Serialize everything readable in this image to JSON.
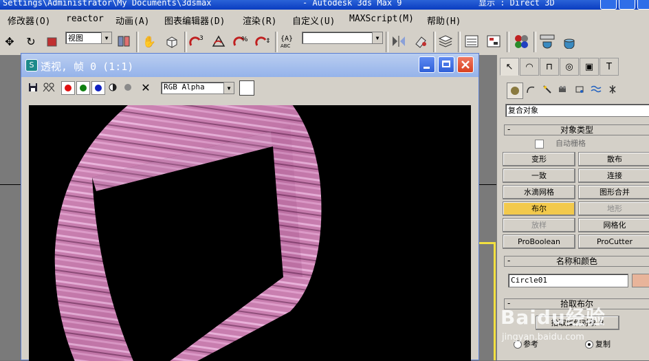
{
  "title_bar": {
    "left_text": "Settings\\Administrator\\My Documents\\3dsmax",
    "app_text": "- Autodesk 3ds Max 9",
    "right_text": "显示 : Direct 3D"
  },
  "menu": [
    "修改器(O)",
    "reactor",
    "动画(A)",
    "图表编辑器(D)",
    "渲染(R)",
    "自定义(U)",
    "MAXScript(M)",
    "帮助(H)"
  ],
  "toolbar": {
    "view_combo": "视图",
    "selection_set_combo": ""
  },
  "render_window": {
    "title": "透视, 帧 0 (1:1)",
    "channel_combo": "RGB Alpha"
  },
  "panel": {
    "category_combo": "复合对象",
    "object_type_title": "对象类型",
    "autogrid_label": "自动栅格",
    "buttons": [
      {
        "label": "变形",
        "state": "normal"
      },
      {
        "label": "散布",
        "state": "normal"
      },
      {
        "label": "一致",
        "state": "normal"
      },
      {
        "label": "连接",
        "state": "normal"
      },
      {
        "label": "水滴网格",
        "state": "normal"
      },
      {
        "label": "图形合并",
        "state": "normal"
      },
      {
        "label": "布尔",
        "state": "active"
      },
      {
        "label": "地形",
        "state": "disabled"
      },
      {
        "label": "放样",
        "state": "disabled"
      },
      {
        "label": "网格化",
        "state": "normal"
      },
      {
        "label": "ProBoolean",
        "state": "normal"
      },
      {
        "label": "ProCutter",
        "state": "normal"
      }
    ],
    "name_color_title": "名称和颜色",
    "object_name": "Circle01",
    "object_color": "#e8b49a",
    "pick_boolean_title": "拾取布尔",
    "pick_operand_button": "拾取操作对象 B",
    "radio_reference": "参考",
    "radio_copy": "复制"
  },
  "watermark": {
    "brand": "Baidu经验",
    "url": "jingyan.baidu.com"
  },
  "colors": {
    "accent_button": "#f2c94c",
    "panel_bg": "#d4d0c8",
    "title_blue": "#0a3cc0"
  }
}
